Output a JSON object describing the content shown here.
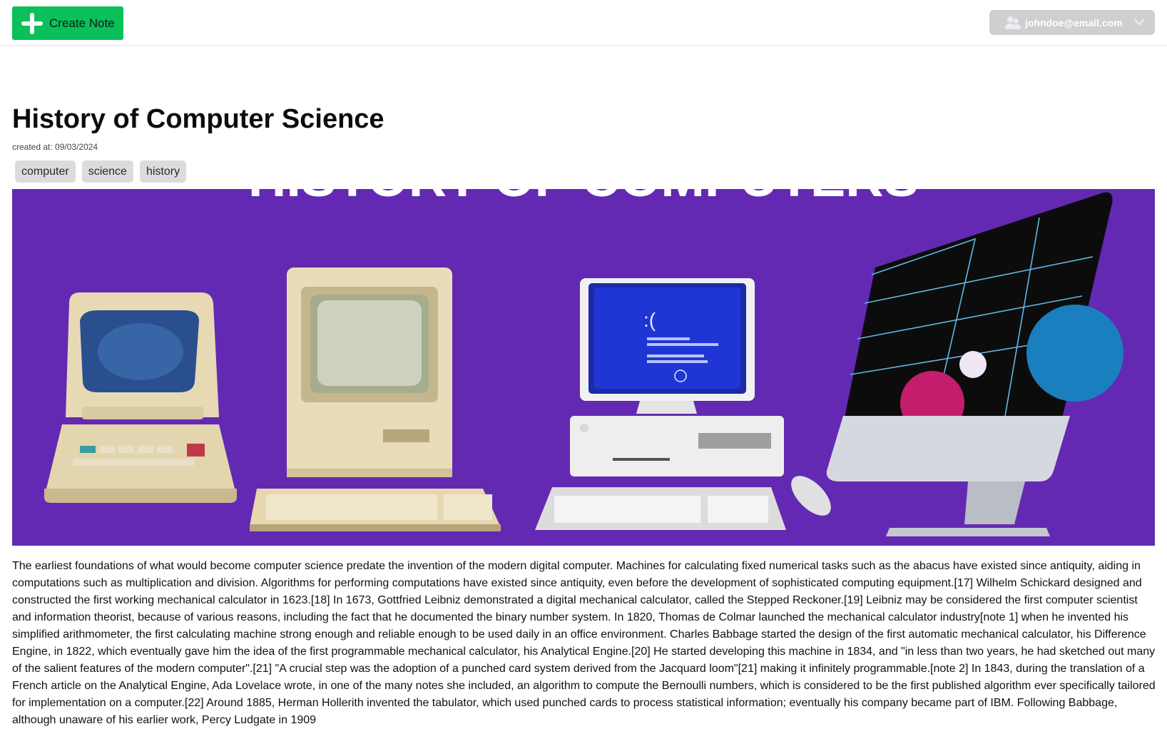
{
  "header": {
    "create_button_label": "Create Note",
    "user_email": "johndoe@email.com"
  },
  "note": {
    "title": "History of Computer Science",
    "created_at": "created at: 09/03/2024",
    "tags": [
      "computer",
      "science",
      "history"
    ],
    "image_banner_text": "HISTORY OF COMPUTERS",
    "screen_face": ":(",
    "body": "The earliest foundations of what would become computer science predate the invention of the modern digital computer. Machines for calculating fixed numerical tasks such as the abacus have existed since antiquity, aiding in computations such as multiplication and division. Algorithms for performing computations have existed since antiquity, even before the development of sophisticated computing equipment.[17] Wilhelm Schickard designed and constructed the first working mechanical calculator in 1623.[18] In 1673, Gottfried Leibniz demonstrated a digital mechanical calculator, called the Stepped Reckoner.[19] Leibniz may be considered the first computer scientist and information theorist, because of various reasons, including the fact that he documented the binary number system. In 1820, Thomas de Colmar launched the mechanical calculator industry[note 1] when he invented his simplified arithmometer, the first calculating machine strong enough and reliable enough to be used daily in an office environment. Charles Babbage started the design of the first automatic mechanical calculator, his Difference Engine, in 1822, which eventually gave him the idea of the first programmable mechanical calculator, his Analytical Engine.[20] He started developing this machine in 1834, and \"in less than two years, he had sketched out many of the salient features of the modern computer\".[21] \"A crucial step was the adoption of a punched card system derived from the Jacquard loom\"[21] making it infinitely programmable.[note 2] In 1843, during the translation of a French article on the Analytical Engine, Ada Lovelace wrote, in one of the many notes she included, an algorithm to compute the Bernoulli numbers, which is considered to be the first published algorithm ever specifically tailored for implementation on a computer.[22] Around 1885, Herman Hollerith invented the tabulator, which used punched cards to process statistical information; eventually his company became part of IBM. Following Babbage, although unaware of his earlier work, Percy Ludgate in 1909"
  },
  "colors": {
    "create_button": "#0bbf5a",
    "user_menu": "#cfcfd2",
    "hero_background": "#6429b3",
    "tag_background": "#dcdcdf"
  },
  "icons": {
    "create": "plus-icon",
    "user": "users-icon",
    "dropdown": "chevron-down-icon"
  }
}
